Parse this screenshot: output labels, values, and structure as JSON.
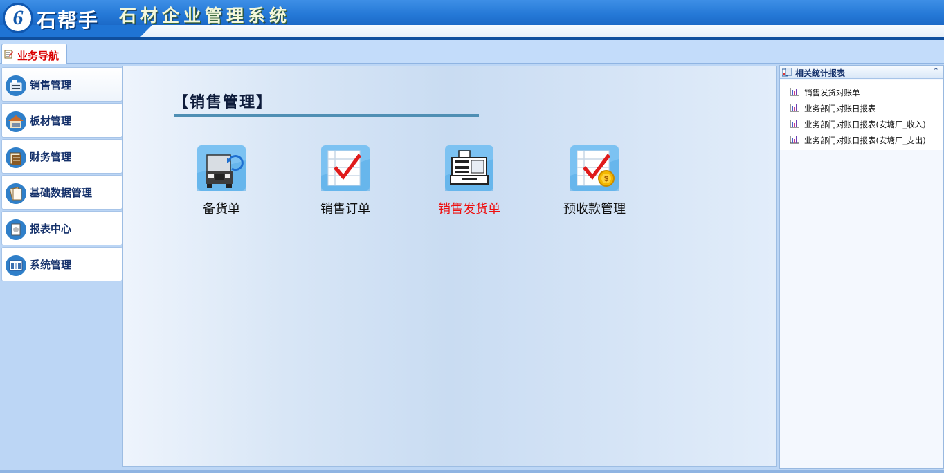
{
  "header": {
    "logo_glyph": "6",
    "brand": "石帮手",
    "system_title": "石材企业管理系统",
    "colors": {
      "primary": "#1f74d4",
      "dark": "#0f4f9e"
    }
  },
  "tabs": [
    {
      "label": "业务导航",
      "icon": "notepad-icon",
      "active": true
    }
  ],
  "sidebar": {
    "items": [
      {
        "label": "销售管理",
        "icon": "cash-register-icon",
        "active": true
      },
      {
        "label": "板材管理",
        "icon": "warehouse-icon",
        "active": false
      },
      {
        "label": "财务管理",
        "icon": "ledger-icon",
        "active": false
      },
      {
        "label": "基础数据管理",
        "icon": "documents-icon",
        "active": false
      },
      {
        "label": "报表中心",
        "icon": "report-icon",
        "active": false
      },
      {
        "label": "系统管理",
        "icon": "settings-window-icon",
        "active": false
      }
    ]
  },
  "main": {
    "title": "【销售管理】",
    "modules": [
      {
        "label": "备货单",
        "icon": "truck-icon",
        "highlight": false
      },
      {
        "label": "销售订单",
        "icon": "checklist-icon",
        "highlight": false
      },
      {
        "label": "销售发货单",
        "icon": "cash-register-icon",
        "highlight": true,
        "highlight_color": "#ee1111"
      },
      {
        "label": "预收款管理",
        "icon": "checklist-coin-icon",
        "highlight": false
      }
    ]
  },
  "right_panel": {
    "title": "相关统计报表",
    "collapse_icon": "double-chevron-up-icon",
    "reports": [
      {
        "label": "销售发货对账单",
        "icon": "bar-chart-icon"
      },
      {
        "label": "业务部门对账日报表",
        "icon": "bar-chart-icon"
      },
      {
        "label": "业务部门对账日报表(安塘厂_收入)",
        "icon": "bar-chart-icon"
      },
      {
        "label": "业务部门对账日报表(安塘厂_支出)",
        "icon": "bar-chart-icon"
      }
    ]
  }
}
